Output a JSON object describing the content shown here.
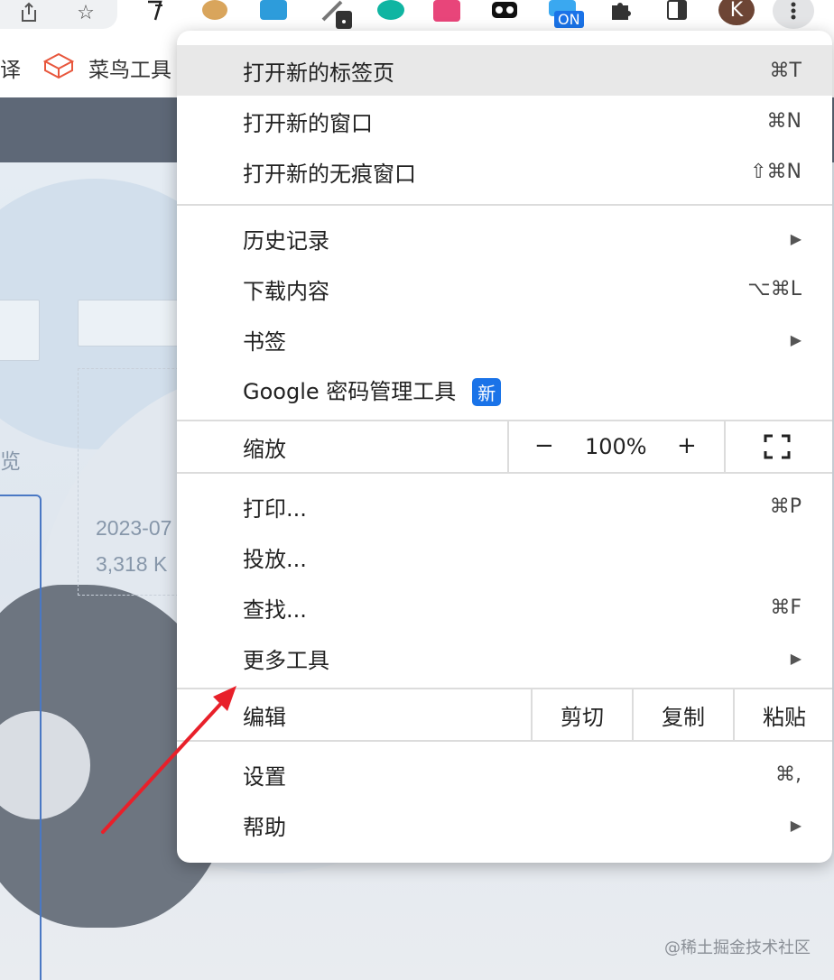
{
  "toolbar": {
    "profile_initial": "K",
    "extension_badge": "ON"
  },
  "bookmarks": {
    "left_partial": "译",
    "runoob": "菜鸟工具"
  },
  "page": {
    "text_partial_left": "览",
    "date_partial": "2023-07",
    "size_partial": "3,318 K"
  },
  "menu": {
    "new_tab": {
      "label": "打开新的标签页",
      "shortcut": "⌘T"
    },
    "new_window": {
      "label": "打开新的窗口",
      "shortcut": "⌘N"
    },
    "new_incognito": {
      "label": "打开新的无痕窗口",
      "shortcut": "⇧⌘N"
    },
    "history": {
      "label": "历史记录"
    },
    "downloads": {
      "label": "下载内容",
      "shortcut": "⌥⌘L"
    },
    "bookmarks": {
      "label": "书签"
    },
    "password_manager": {
      "label": "Google 密码管理工具",
      "badge": "新"
    },
    "zoom": {
      "label": "缩放",
      "minus": "−",
      "value": "100%",
      "plus": "+"
    },
    "print": {
      "label": "打印...",
      "shortcut": "⌘P"
    },
    "cast": {
      "label": "投放..."
    },
    "find": {
      "label": "查找...",
      "shortcut": "⌘F"
    },
    "more_tools": {
      "label": "更多工具"
    },
    "edit": {
      "label": "编辑",
      "cut": "剪切",
      "copy": "复制",
      "paste": "粘贴"
    },
    "settings": {
      "label": "设置",
      "shortcut": "⌘,"
    },
    "help": {
      "label": "帮助"
    }
  },
  "watermark": "@稀土掘金技术社区",
  "colors": {
    "accent": "#1a73e8",
    "highlight_row": "#e8e8e8",
    "annotation_arrow": "#e8202a"
  }
}
